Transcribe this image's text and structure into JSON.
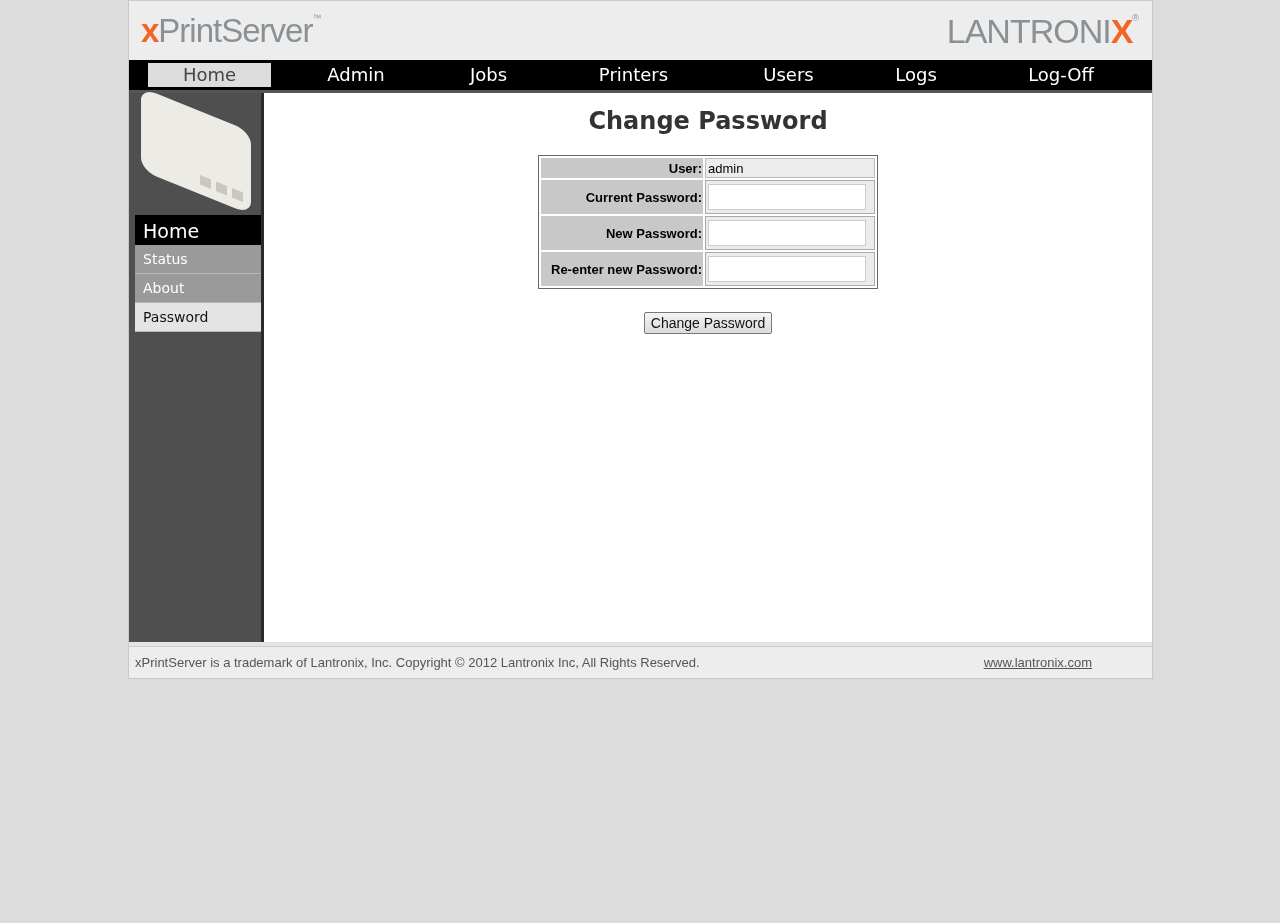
{
  "header": {
    "product_logo": {
      "accent": "x",
      "text": "PrintServer",
      "mark": "™"
    },
    "brand_logo": {
      "text": "LANTRONI",
      "accent": "X",
      "mark": "®"
    }
  },
  "nav": [
    {
      "label": "Home",
      "selected": true
    },
    {
      "label": "Admin",
      "selected": false
    },
    {
      "label": "Jobs",
      "selected": false
    },
    {
      "label": "Printers",
      "selected": false
    },
    {
      "label": "Users",
      "selected": false
    },
    {
      "label": "Logs",
      "selected": false
    },
    {
      "label": "Log-Off",
      "selected": false
    }
  ],
  "sidebar": {
    "heading": "Home",
    "items": [
      {
        "label": "Status",
        "selected": false
      },
      {
        "label": "About",
        "selected": false
      },
      {
        "label": "Password",
        "selected": true
      }
    ]
  },
  "form": {
    "title": "Change Password",
    "rows": [
      {
        "kind": "text",
        "label": "User:",
        "value": "admin"
      },
      {
        "kind": "input",
        "label": "Current Password:"
      },
      {
        "kind": "input",
        "label": "New Password:"
      },
      {
        "kind": "input",
        "label": "Re-enter new Password:"
      }
    ],
    "submit": "Change Password"
  },
  "footer": {
    "copyright": "xPrintServer is a trademark of Lantronix, Inc. Copyright © 2012 Lantronix Inc, All Rights Reserved.",
    "link": "www.lantronix.com"
  }
}
